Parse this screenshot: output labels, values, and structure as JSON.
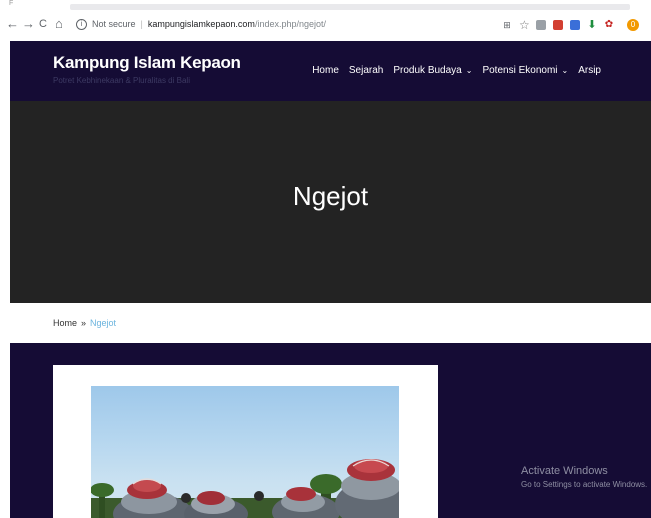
{
  "browser": {
    "tiny_mark": "F",
    "back_icon": "←",
    "forward_icon": "→",
    "reload_icon": "C",
    "home_icon": "⌂",
    "info_icon": "i",
    "security_label": "Not secure",
    "url_host": "kampungislamkepaon.com",
    "url_path": "/index.php/ngejot/",
    "extensions": [
      "translate-icon",
      "star-icon",
      "ext-icon",
      "ext-icon",
      "ext-icon",
      "download-icon",
      "ext-icon"
    ],
    "avatar": "0",
    "menu": "⋮"
  },
  "site": {
    "title": "Kampung Islam Kepaon",
    "tagline": "Potret Kebhinekaan & Pluralitas di Bali",
    "nav": [
      {
        "label": "Home",
        "dropdown": false
      },
      {
        "label": "Sejarah",
        "dropdown": false
      },
      {
        "label": "Produk Budaya",
        "dropdown": true
      },
      {
        "label": "Potensi Ekonomi",
        "dropdown": true
      },
      {
        "label": "Arsip",
        "dropdown": false
      }
    ]
  },
  "hero": {
    "title": "Ngejot"
  },
  "breadcrumb": {
    "home": "Home",
    "separator": "»",
    "current": "Ngejot"
  },
  "watermark": {
    "title": "Activate Windows",
    "subtitle": "Go to Settings to activate Windows."
  },
  "colors": {
    "header_bg": "#150c35",
    "hero_bg": "#232323",
    "breadcrumb_link": "#6bb4de"
  }
}
